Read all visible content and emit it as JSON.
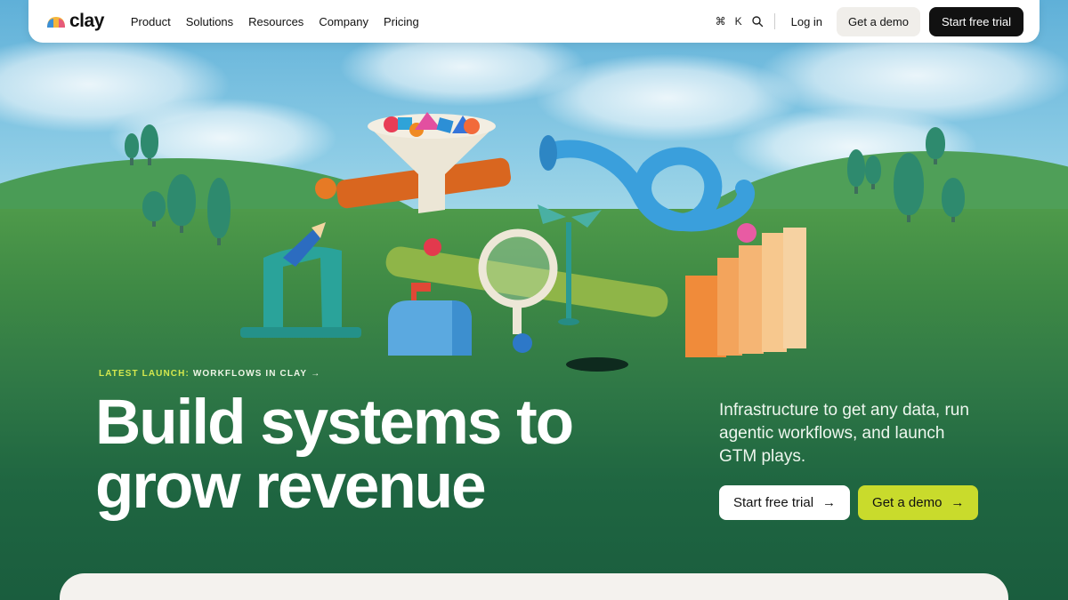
{
  "header": {
    "logo_text": "clay",
    "nav": [
      "Product",
      "Solutions",
      "Resources",
      "Company",
      "Pricing"
    ],
    "shortcut_cmd": "⌘",
    "shortcut_key": "K",
    "login_label": "Log in",
    "demo_label": "Get a demo",
    "trial_label": "Start free trial"
  },
  "hero": {
    "launch_prefix": "LATEST LAUNCH:",
    "launch_text": "WORKFLOWS IN CLAY",
    "launch_arrow": "→",
    "headline_line1": "Build systems to",
    "headline_line2": "grow revenue",
    "subtext": "Infrastructure to get any data, run agentic workflows, and launch GTM plays.",
    "cta_trial": "Start free trial",
    "cta_demo": "Get a demo",
    "cta_arrow": "→"
  },
  "colors": {
    "accent_lime": "#c9db2c",
    "launch_label": "#d4e84e",
    "dark_button": "#111111",
    "ground_green": "#1f6641"
  },
  "icons": {
    "logo": "clay-logo-icon",
    "search": "search-icon",
    "arrow": "arrow-right-icon"
  }
}
